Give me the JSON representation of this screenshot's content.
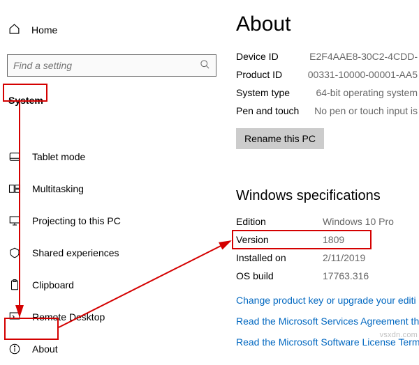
{
  "sidebar": {
    "home_label": "Home",
    "search_placeholder": "Find a setting",
    "section_label": "System",
    "items": [
      {
        "label": "Tablet mode"
      },
      {
        "label": "Multitasking"
      },
      {
        "label": "Projecting to this PC"
      },
      {
        "label": "Shared experiences"
      },
      {
        "label": "Clipboard"
      },
      {
        "label": "Remote Desktop"
      },
      {
        "label": "About"
      }
    ]
  },
  "content": {
    "title": "About",
    "device": {
      "device_id_label": "Device ID",
      "device_id_value": "E2F4AAE8-30C2-4CDD-",
      "product_id_label": "Product ID",
      "product_id_value": "00331-10000-00001-AA5",
      "system_type_label": "System type",
      "system_type_value": "64-bit operating system",
      "pen_touch_label": "Pen and touch",
      "pen_touch_value": "No pen or touch input is"
    },
    "rename_button": "Rename this PC",
    "spec_heading": "Windows specifications",
    "spec": {
      "edition_label": "Edition",
      "edition_value": "Windows 10 Pro",
      "version_label": "Version",
      "version_value": "1809",
      "installed_label": "Installed on",
      "installed_value": "2/11/2019",
      "build_label": "OS build",
      "build_value": "17763.316"
    },
    "link_product_key": "Change product key or upgrade your editi",
    "link_services": "Read the Microsoft Services Agreement tha",
    "link_license": "Read the Microsoft Software License Terms"
  },
  "watermark": "vsxdn.com"
}
